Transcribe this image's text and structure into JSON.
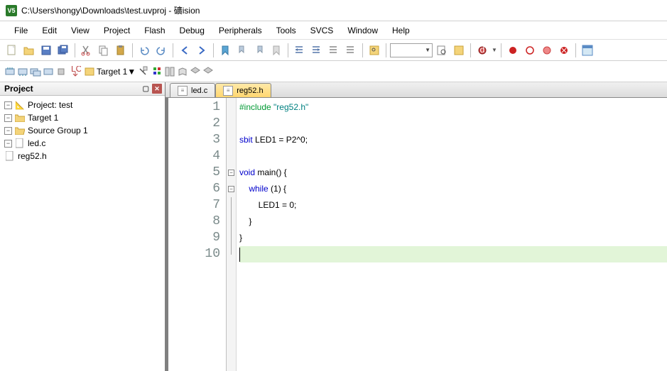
{
  "title": "C:\\Users\\hongy\\Downloads\\test.uvproj - 礦ision",
  "app_icon_text": "V5",
  "menu": [
    "File",
    "Edit",
    "View",
    "Project",
    "Flash",
    "Debug",
    "Peripherals",
    "Tools",
    "SVCS",
    "Window",
    "Help"
  ],
  "target_selector": "Target 1",
  "project_panel_title": "Project",
  "tree": {
    "root": "Project: test",
    "target": "Target 1",
    "group": "Source Group 1",
    "file1": "led.c",
    "file2": "reg52.h"
  },
  "tabs": [
    {
      "label": "led.c",
      "active": false
    },
    {
      "label": "reg52.h",
      "active": true
    }
  ],
  "code_lines": [
    {
      "n": 1,
      "fold": "",
      "html": "<span class='pp'>#include </span><span class='str'>\"reg52.h\"</span>"
    },
    {
      "n": 2,
      "fold": "",
      "html": ""
    },
    {
      "n": 3,
      "fold": "",
      "html": "<span class='kw'>sbit</span> LED1 = P2^0;"
    },
    {
      "n": 4,
      "fold": "",
      "html": ""
    },
    {
      "n": 5,
      "fold": "box",
      "html": "<span class='kw'>void</span> main() {"
    },
    {
      "n": 6,
      "fold": "box",
      "html": "    <span class='kw'>while</span> (1) {"
    },
    {
      "n": 7,
      "fold": "line",
      "html": "        LED1 = 0;"
    },
    {
      "n": 8,
      "fold": "line",
      "html": "    }"
    },
    {
      "n": 9,
      "fold": "line",
      "html": "}"
    },
    {
      "n": 10,
      "fold": "end",
      "html": "",
      "cursor": true
    }
  ]
}
